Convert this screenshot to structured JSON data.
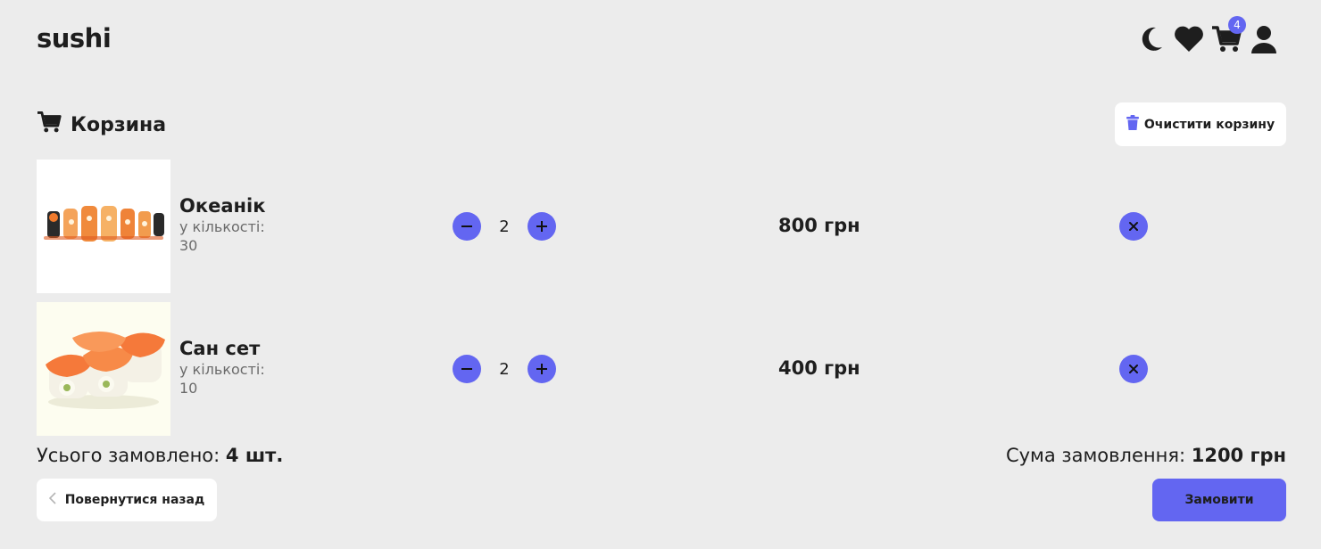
{
  "header": {
    "logo": "sushi",
    "icons": [
      "moon-icon",
      "heart-icon",
      "cart-icon",
      "user-icon"
    ],
    "cart_count": "4"
  },
  "cart": {
    "title": "Корзина",
    "clear_label": "Очистити корзину",
    "items": [
      {
        "name": "Океанік",
        "qty_label": "у кількості:",
        "qty": "30",
        "count": "2",
        "price": "800 грн"
      },
      {
        "name": "Сан сет",
        "qty_label": "у кількості:",
        "qty": "10",
        "count": "2",
        "price": "400 грн"
      }
    ]
  },
  "summary": {
    "total_label": "Усього замовлено:",
    "total_value": "4 шт.",
    "sum_label": "Сума замовлення:",
    "sum_value": "1200 грн"
  },
  "actions": {
    "back_label": "Повернутися назад",
    "order_label": "Замовити"
  },
  "colors": {
    "accent": "#6366f1",
    "background": "#ececec",
    "text": "#1e1e1e"
  }
}
